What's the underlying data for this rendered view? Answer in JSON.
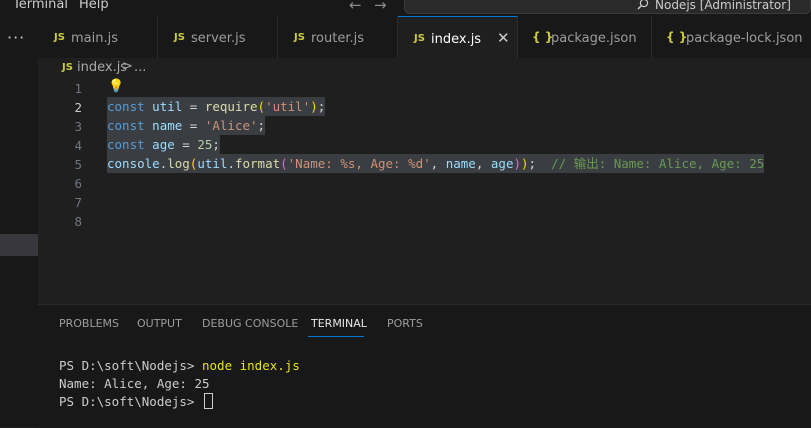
{
  "menu": {
    "terminal": "Terminal",
    "help": "Help"
  },
  "command_center": {
    "text": "Nodejs [Administrator]"
  },
  "activity": {
    "more": "···"
  },
  "tabs": [
    {
      "label": "main.js",
      "icon": "JS"
    },
    {
      "label": "server.js",
      "icon": "JS"
    },
    {
      "label": "router.js",
      "icon": "JS"
    },
    {
      "label": "index.js",
      "icon": "JS",
      "active": true,
      "close": "✕"
    },
    {
      "label": "package.json",
      "icon": "{ }"
    },
    {
      "label": "package-lock.json",
      "icon": "{ }"
    }
  ],
  "breadcrumb": {
    "icon": "JS",
    "file": "index.js",
    "separator": ">",
    "more": "..."
  },
  "editor": {
    "line_numbers": [
      "1",
      "2",
      "3",
      "4",
      "5",
      "6",
      "7",
      "8"
    ],
    "lines": {
      "l2": {
        "k": "const",
        "v": "util",
        "eq": " = ",
        "f": "require",
        "o": "(",
        "s": "'util'",
        "c": ")",
        "end": ";"
      },
      "l3": {
        "k": "const",
        "v": "name",
        "eq": " = ",
        "s": "'Alice'",
        "end": ";"
      },
      "l4": {
        "k": "const",
        "v": "age",
        "eq": " = ",
        "n": "25",
        "end": ";"
      },
      "l5": {
        "obj": "console",
        "dot1": ".",
        "f1": "log",
        "o1": "(",
        "obj2": "util",
        "dot2": ".",
        "f2": "format",
        "o2": "(",
        "s": "'Name: %s, Age: %d'",
        "cm1": ", ",
        "a1": "name",
        "cm2": ", ",
        "a2": "age",
        "c2": ")",
        "c1": ")",
        "end": ";",
        "comment": "  // 输出: Name: Alice, Age: 25"
      }
    }
  },
  "panel": {
    "tabs": [
      "PROBLEMS",
      "OUTPUT",
      "DEBUG CONSOLE",
      "TERMINAL",
      "PORTS"
    ],
    "active_tab": "TERMINAL",
    "terminal": {
      "prompt1": "PS D:\\soft\\Nodejs> ",
      "cmd1": "node index.js",
      "output": "Name: Alice, Age: 25",
      "prompt2": "PS D:\\soft\\Nodejs> "
    }
  },
  "colors": {
    "accent": "#0078d4",
    "js_icon": "#cbcb41",
    "lightbulb": "#ffcc00"
  }
}
